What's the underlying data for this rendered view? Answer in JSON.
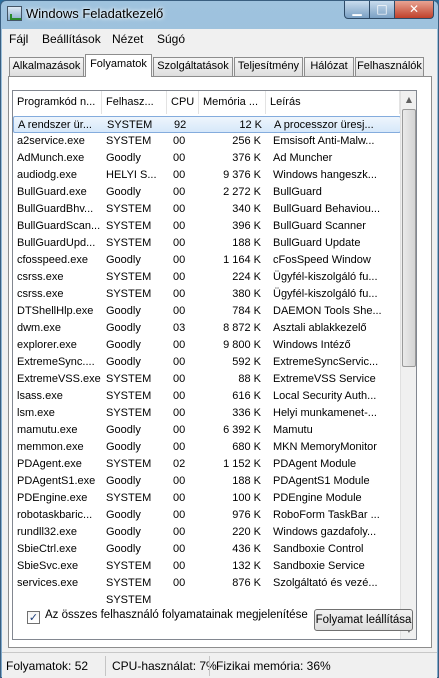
{
  "window": {
    "title": "Windows Feladatkezelő"
  },
  "controls": {
    "minimize": "▁",
    "maximize": "□",
    "close": "✕"
  },
  "menu": [
    "Fájl",
    "Beállítások",
    "Nézet",
    "Súgó"
  ],
  "tabs": [
    "Alkalmazások",
    "Folyamatok",
    "Szolgáltatások",
    "Teljesítmény",
    "Hálózat",
    "Felhasználók"
  ],
  "active_tab": "Folyamatok",
  "columns": [
    "Programkód n...",
    "Felhasz...",
    "CPU",
    "Memória ...",
    "Leírás"
  ],
  "processes": [
    [
      "A rendszer ür...",
      "SYSTEM",
      "92",
      "12 K",
      "A processzor üresj..."
    ],
    [
      "a2service.exe",
      "SYSTEM",
      "00",
      "256 K",
      "Emsisoft Anti-Malw..."
    ],
    [
      "AdMunch.exe",
      "Goodly",
      "00",
      "376 K",
      "Ad Muncher"
    ],
    [
      "audiodg.exe",
      "HELYI S...",
      "00",
      "9 376 K",
      "Windows hangeszk..."
    ],
    [
      "BullGuard.exe",
      "Goodly",
      "00",
      "2 272 K",
      "BullGuard"
    ],
    [
      "BullGuardBhv...",
      "SYSTEM",
      "00",
      "340 K",
      "BullGuard Behaviou..."
    ],
    [
      "BullGuardScan...",
      "SYSTEM",
      "00",
      "396 K",
      "BullGuard Scanner"
    ],
    [
      "BullGuardUpd...",
      "SYSTEM",
      "00",
      "188 K",
      "BullGuard Update"
    ],
    [
      "cfosspeed.exe",
      "Goodly",
      "00",
      "1 164 K",
      "cFosSpeed Window"
    ],
    [
      "csrss.exe",
      "SYSTEM",
      "00",
      "224 K",
      "Ügyfél-kiszolgáló fu..."
    ],
    [
      "csrss.exe",
      "SYSTEM",
      "00",
      "380 K",
      "Ügyfél-kiszolgáló fu..."
    ],
    [
      "DTShellHlp.exe",
      "Goodly",
      "00",
      "784 K",
      "DAEMON Tools She..."
    ],
    [
      "dwm.exe",
      "Goodly",
      "03",
      "8 872 K",
      "Asztali ablakkezelő"
    ],
    [
      "explorer.exe",
      "Goodly",
      "00",
      "9 800 K",
      "Windows Intéző"
    ],
    [
      "ExtremeSync....",
      "Goodly",
      "00",
      "592 K",
      "ExtremeSyncServic..."
    ],
    [
      "ExtremeVSS.exe",
      "SYSTEM",
      "00",
      "88 K",
      "ExtremeVSS Service"
    ],
    [
      "lsass.exe",
      "SYSTEM",
      "00",
      "616 K",
      "Local Security Auth..."
    ],
    [
      "lsm.exe",
      "SYSTEM",
      "00",
      "336 K",
      "Helyi munkamenet-..."
    ],
    [
      "mamutu.exe",
      "Goodly",
      "00",
      "6 392 K",
      "Mamutu"
    ],
    [
      "memmon.exe",
      "Goodly",
      "00",
      "680 K",
      "MKN MemoryMonitor"
    ],
    [
      "PDAgent.exe",
      "SYSTEM",
      "02",
      "1 152 K",
      "PDAgent Module"
    ],
    [
      "PDAgentS1.exe",
      "Goodly",
      "00",
      "188 K",
      "PDAgentS1 Module"
    ],
    [
      "PDEngine.exe",
      "SYSTEM",
      "00",
      "100 K",
      "PDEngine Module"
    ],
    [
      "robotaskbaric...",
      "Goodly",
      "00",
      "976 K",
      "RoboForm TaskBar ..."
    ],
    [
      "rundll32.exe",
      "Goodly",
      "00",
      "220 K",
      "Windows gazdafoly..."
    ],
    [
      "SbieCtrl.exe",
      "Goodly",
      "00",
      "436 K",
      "Sandboxie Control"
    ],
    [
      "SbieSvc.exe",
      "SYSTEM",
      "00",
      "132 K",
      "Sandboxie Service"
    ],
    [
      "services.exe",
      "SYSTEM",
      "00",
      "876 K",
      "Szolgáltató és vezé..."
    ],
    [
      "",
      "SYSTEM",
      "",
      "",
      ""
    ]
  ],
  "show_all_users": {
    "label": "Az összes felhasználó folyamatainak megjelenítése",
    "checked": "✓"
  },
  "end_process_button": "Folyamat leállítása",
  "status": {
    "processes": "Folyamatok: 52",
    "cpu": "CPU-használat: 7%",
    "memory": "Fizikai memória: 36%"
  },
  "scrollbar": {
    "up": "▲",
    "down": "▼"
  }
}
